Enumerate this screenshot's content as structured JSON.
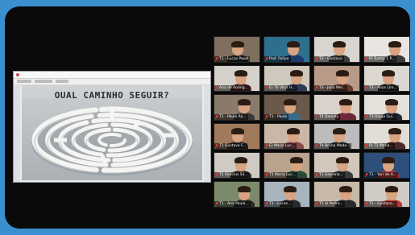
{
  "slide": {
    "title": "QUAL CAMINHO SEGUIR?"
  },
  "colors": {
    "background": "#3a8fcf",
    "frame": "#0a0a0a",
    "muted_mic": "#e03b3b"
  },
  "participants": [
    {
      "name": "T1 - Lucas Pavel",
      "bg": "#7e6f5e",
      "shirt": "#2a2a2a"
    },
    {
      "name": "Prof. Felipe",
      "bg": "#2f6f8e",
      "shirt": "#1b3d6b"
    },
    {
      "name": "T3 - Gustavo",
      "bg": "#d8d4cf",
      "shirt": "#3b3b3b"
    },
    {
      "name": "P) Turma 1 P...",
      "bg": "#e9e6e1",
      "shirt": "#3b3b3b"
    },
    {
      "name": "Ana de Rodrig...",
      "bg": "#d5d2cc",
      "shirt": "#5a2a2a"
    },
    {
      "name": "E) T6 Vitor H...",
      "bg": "#cfc8bd",
      "shirt": "#2f3b55"
    },
    {
      "name": "T3 - Julia Mel...",
      "bg": "#b99a88",
      "shirt": "#6a3a2a"
    },
    {
      "name": "T3 - Alice Lim...",
      "bg": "#dcd7cf",
      "shirt": "#2a2a2a"
    },
    {
      "name": "T1 - Paulo Ro...",
      "bg": "#8a7a6a",
      "shirt": "#3a3a3a"
    },
    {
      "name": "T1 - Paulo",
      "bg": "#6b5a4c",
      "shirt": "#3a6b8a"
    },
    {
      "name": "T4 Daniely",
      "bg": "#d8d2cb",
      "shirt": "#6a2a3a"
    },
    {
      "name": "T3 Diogo Gui...",
      "bg": "#e4e0da",
      "shirt": "#1f2a3a"
    },
    {
      "name": "T1 Gustavo F...",
      "bg": "#a07a5a",
      "shirt": "#2a2a2a"
    },
    {
      "name": "E) Maria Luc...",
      "bg": "#c9b8a8",
      "shirt": "#8a4a4a"
    },
    {
      "name": "T4 Bruna Mede...",
      "bg": "#bcbcbc",
      "shirt": "#2f2f2f"
    },
    {
      "name": "P) T1 Maria...",
      "bg": "#e2ddd6",
      "shirt": "#4a2a2a"
    },
    {
      "name": "T1 Vinicius Sil...",
      "bg": "#cfcac3",
      "shirt": "#2a2a2a"
    },
    {
      "name": "T1 Maria Luc...",
      "bg": "#b8a38d",
      "shirt": "#2a4a3a"
    },
    {
      "name": "T1 Giovana...",
      "bg": "#d1c7bb",
      "shirt": "#3a3a3a"
    },
    {
      "name": "T1 - Yuri de A...",
      "bg": "#2d4f7a",
      "shirt": "#b83a3a"
    },
    {
      "name": "T1 - Ana Paula...",
      "bg": "#7a8a6a",
      "shirt": "#2a2a2a"
    },
    {
      "name": "T1 - Lucas...",
      "bg": "#a7b3bd",
      "shirt": "#2a2a2a"
    },
    {
      "name": "T1 Ai Pedro...",
      "bg": "#c7b9a8",
      "shirt": "#2a2a2a"
    },
    {
      "name": "T1 - Gustavo...",
      "bg": "#d0cbc4",
      "shirt": "#b83a3a"
    }
  ]
}
